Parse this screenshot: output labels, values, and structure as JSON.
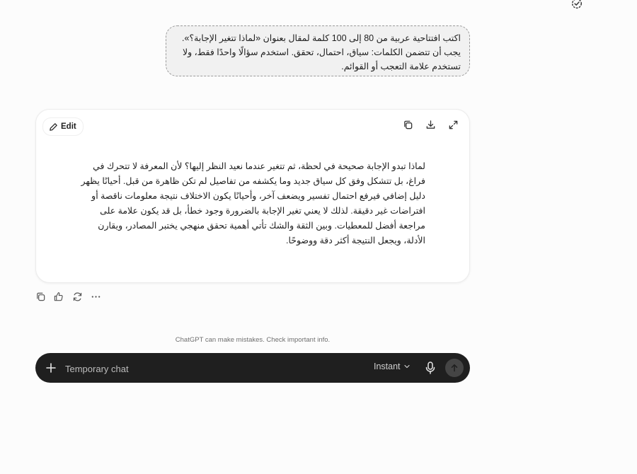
{
  "user_message": {
    "lines": [
      "اكتب افتتاحية عربية من 80 إلى 100 كلمة لمقال بعنوان «لماذا تتغير الإجابة؟».",
      "يجب أن تتضمن الكلمات: سياق، احتمال، تحقق. استخدم سؤالًا واحدًا فقط، ولا",
      "تستخدم علامة التعجب أو القوائم."
    ]
  },
  "canvas": {
    "edit_label": "Edit",
    "tools": [
      "copy-icon",
      "download-icon",
      "expand-icon"
    ],
    "content_lines": [
      "لماذا تبدو الإجابة صحيحة في لحظة، ثم تتغير عندما نعيد النظر إليها؟ لأن المعرفة لا تتحرك في",
      "فراغ، بل تتشكل وفق كل سياق جديد وما يكشفه من تفاصيل لم تكن ظاهرة من قبل. أحيانًا يظهر",
      "دليل إضافي فيرفع احتمال تفسير ويضعف آخر، وأحيانًا يكون الاختلاف نتيجة معلومات ناقصة أو",
      "افتراضات غير دقيقة. لذلك لا يعني تغير الإجابة بالضرورة وجود خطأ، بل قد يكون علامة على",
      "مراجعة أفضل للمعطيات. وبين الثقة والشك تأتي أهمية تحقق منهجي يختبر المصادر، ويقارن",
      "الأدلة، ويجعل النتيجة أكثر دقة ووضوحًا."
    ]
  },
  "message_actions": [
    "copy-icon",
    "thumbs-icon",
    "regenerate-icon",
    "more-icon"
  ],
  "disclaimer": "ChatGPT can make mistakes. Check important info.",
  "composer": {
    "placeholder": "Temporary chat",
    "model": "Instant"
  }
}
